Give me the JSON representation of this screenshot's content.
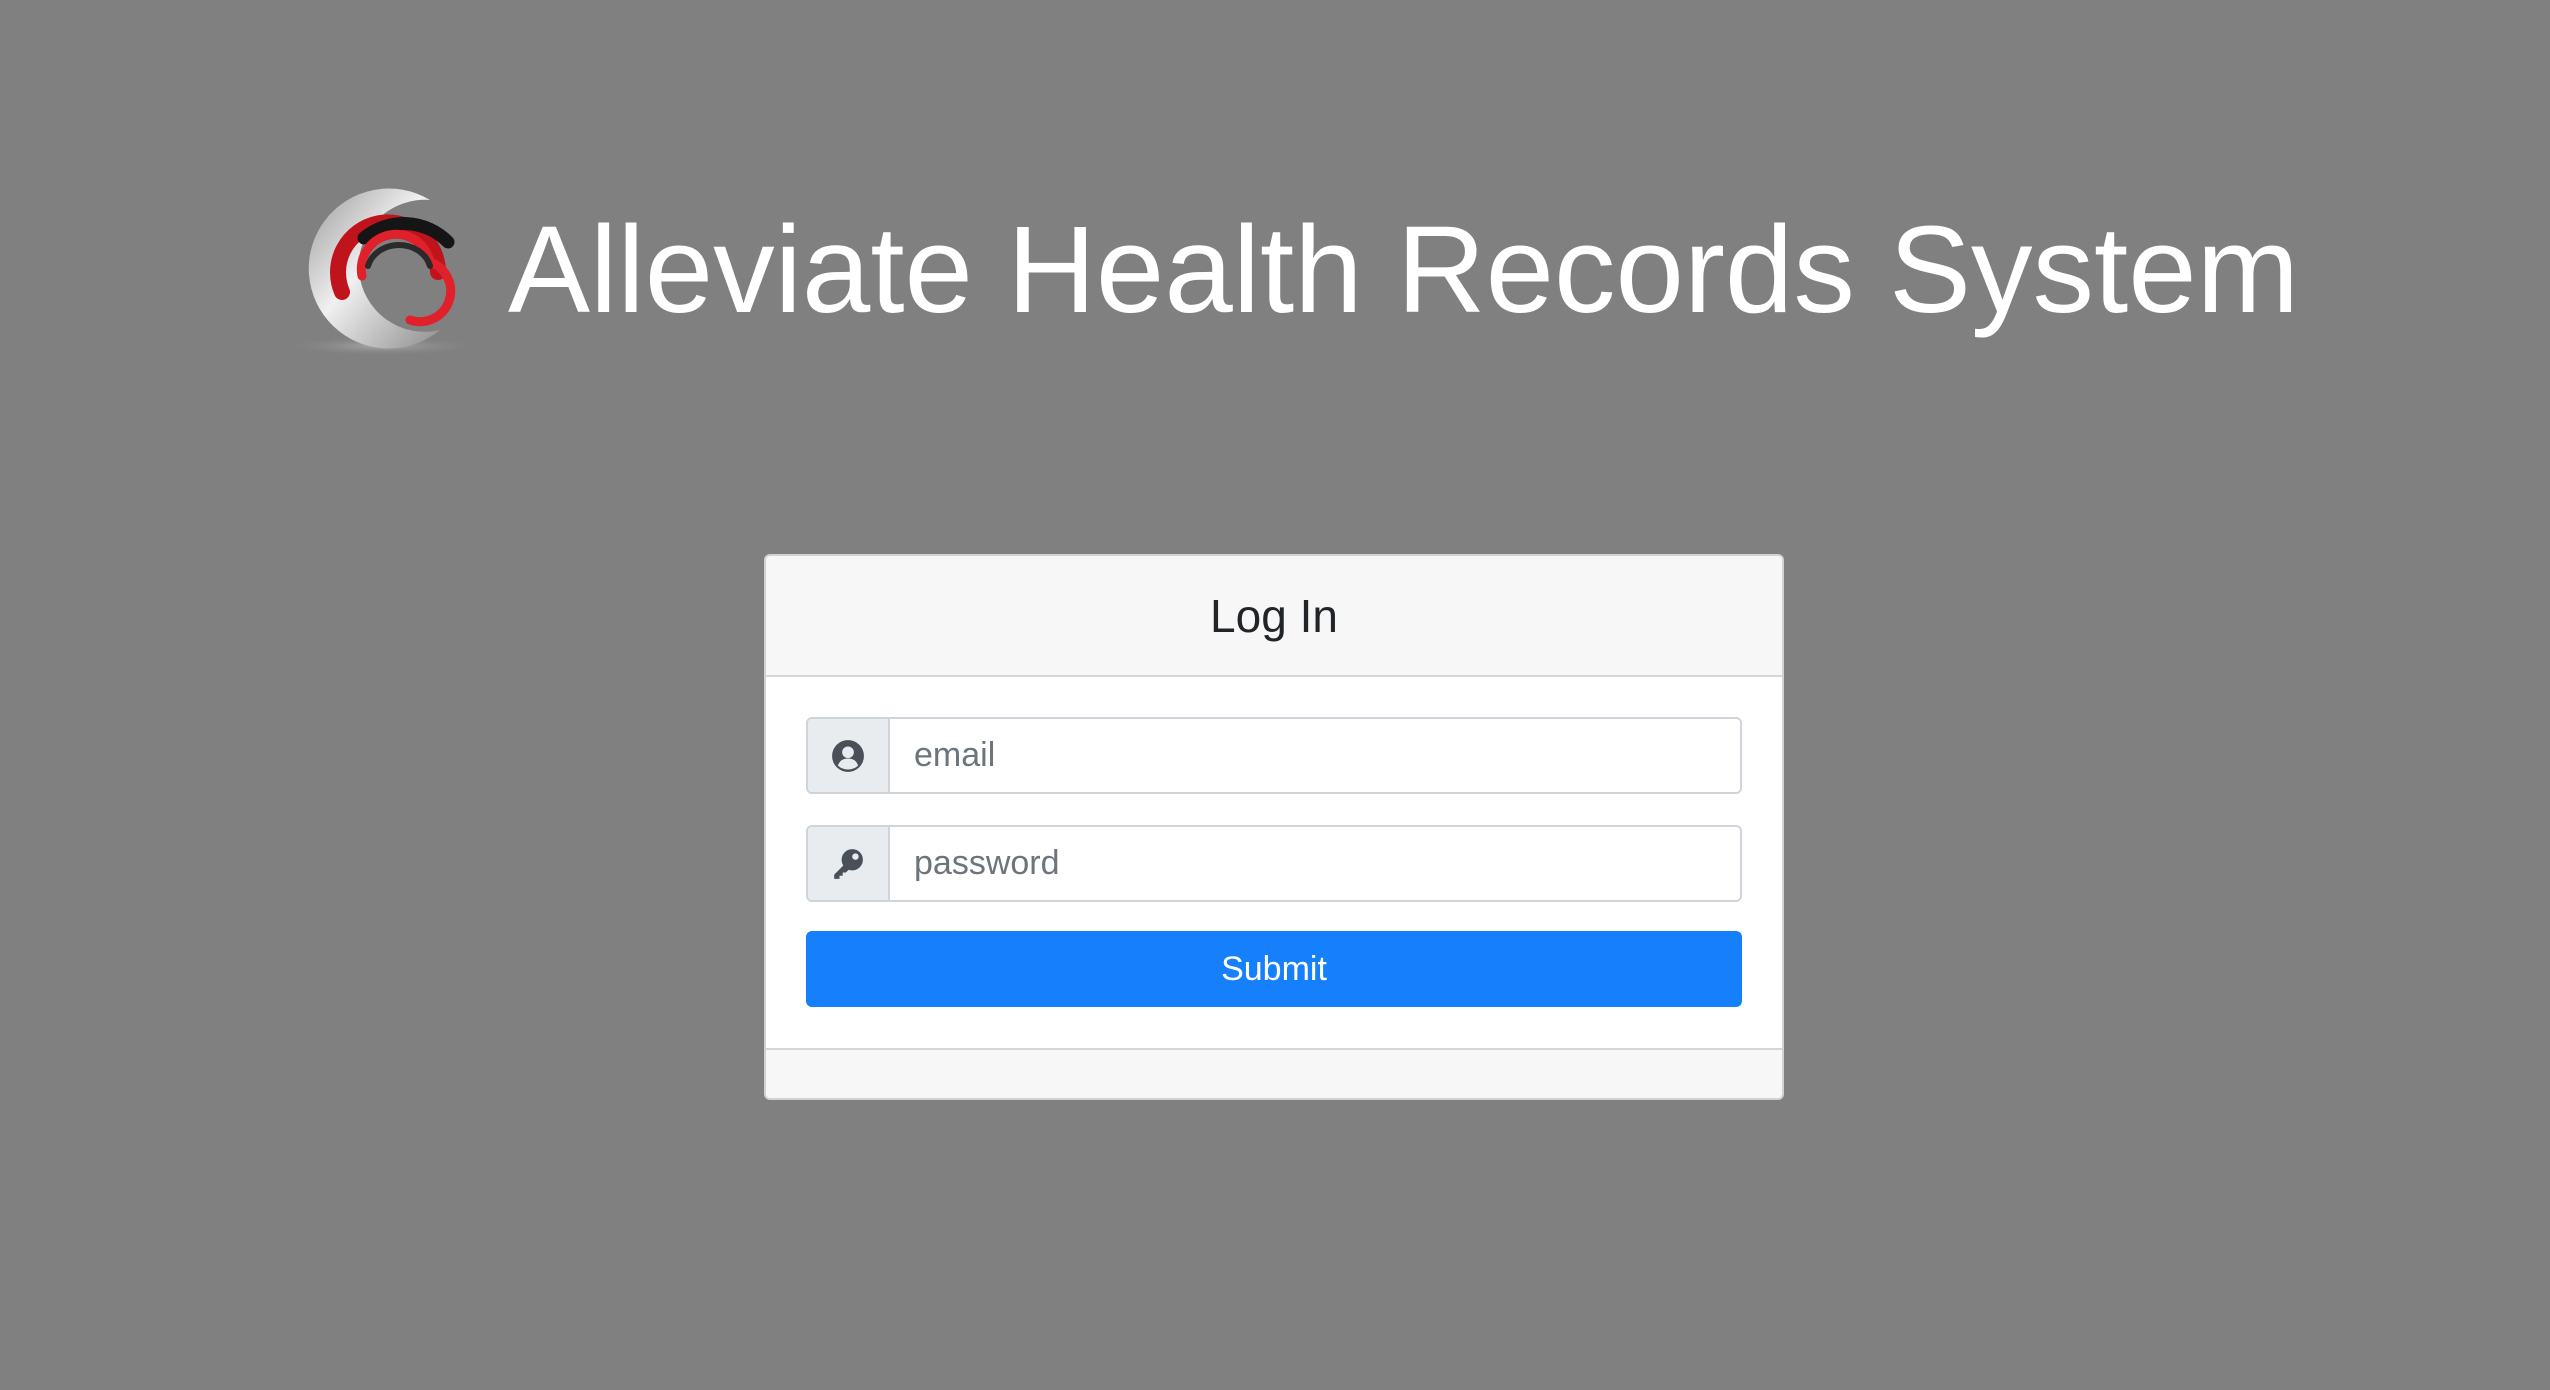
{
  "header": {
    "title": "Alleviate Health Records System",
    "logo_icon": "circular-swoosh-logo"
  },
  "login": {
    "heading": "Log In",
    "email": {
      "placeholder": "email",
      "value": "",
      "icon": "user-circle-icon"
    },
    "password": {
      "placeholder": "password",
      "value": "",
      "icon": "key-icon"
    },
    "submit_label": "Submit"
  },
  "colors": {
    "page_background": "#808080",
    "primary_button": "#167ffc",
    "logo_red": "#e0202a",
    "logo_dark": "#1a1a1a"
  }
}
